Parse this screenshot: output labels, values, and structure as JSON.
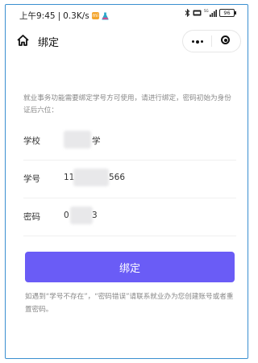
{
  "status_bar": {
    "time": "上午9:45",
    "network_speed": "0.3K/s",
    "battery_level": "96",
    "signal_label": "5G"
  },
  "nav": {
    "title": "绑定"
  },
  "notice_text": "就业事务功能需要绑定学号方可使用，请进行绑定，密码初始为身份证后六位：",
  "form": {
    "school": {
      "label": "学校",
      "value_visible": "学"
    },
    "student_id": {
      "label": "学号",
      "value_prefix": "11",
      "value_suffix": "566"
    },
    "password": {
      "label": "密码",
      "value_prefix": "0",
      "value_suffix": "3"
    }
  },
  "submit_label": "绑定",
  "help_text": "如遇到“学号不存在”，“密码错误”请联系就业办为您创建账号或者重置密码。",
  "colors": {
    "accent": "#6a5cf6",
    "frame_border": "#3a8fd0",
    "muted_text": "#888888"
  }
}
